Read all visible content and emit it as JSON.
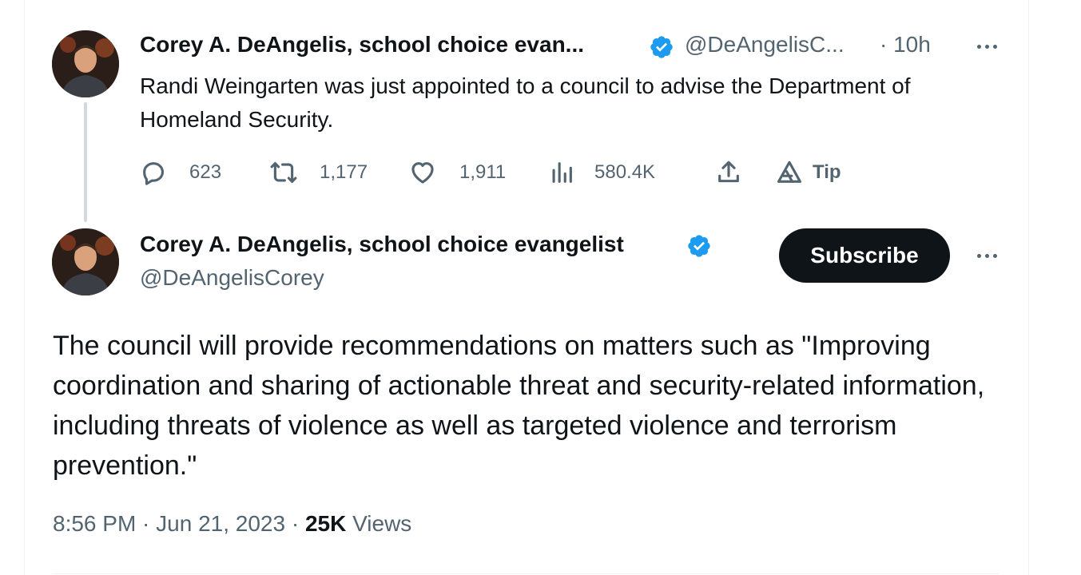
{
  "reply_tweet": {
    "author_name": "Corey A. DeAngelis, school choice evan...",
    "handle": "@DeAngelisC...",
    "time": "· 10h",
    "text": "Randi Weingarten was just appointed to a council to advise the Department of Homeland Security.",
    "stats": {
      "replies": "623",
      "retweets": "1,177",
      "likes": "1,911",
      "views": "580.4K",
      "tip_label": "Tip"
    }
  },
  "main_tweet": {
    "author_name": "Corey A. DeAngelis, school choice evangelist",
    "handle": "@DeAngelisCorey",
    "subscribe_label": "Subscribe",
    "text": "The council will provide recommendations on matters such as \"Improving coordination and sharing of actionable threat and security-related information, including threats of violence as well as targeted violence and terrorism prevention.\"",
    "timestamp": "8:56 PM · Jun 21, 2023 · ",
    "views_count": "25K",
    "views_label": " Views"
  },
  "colors": {
    "verified_blue": "#1d9bf0",
    "text_primary": "#0f1419",
    "text_secondary": "#536471",
    "button_dark": "#0f1419"
  },
  "icons": [
    "verified-badge-icon",
    "more-icon",
    "reply-icon",
    "retweet-icon",
    "like-icon",
    "views-icon",
    "share-icon",
    "tip-icon"
  ]
}
